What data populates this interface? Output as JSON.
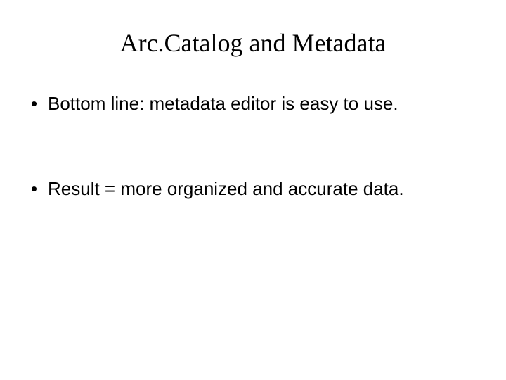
{
  "title": "Arc.Catalog and Metadata",
  "bullets": [
    "Bottom line: metadata editor is easy to use.",
    "Result = more organized and accurate data."
  ]
}
